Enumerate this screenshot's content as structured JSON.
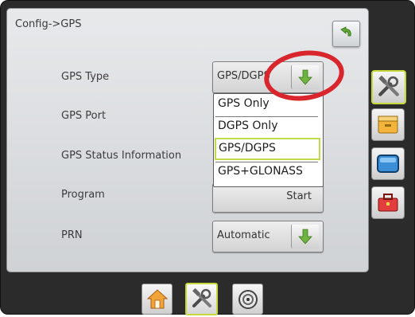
{
  "breadcrumb": "Config->GPS",
  "rows": [
    {
      "label": "GPS Type"
    },
    {
      "label": "GPS Port"
    },
    {
      "label": "GPS Status Information"
    },
    {
      "label": "Program",
      "button": "Start"
    },
    {
      "label": "PRN",
      "value": "Automatic"
    }
  ],
  "gps_type": {
    "value": "GPS/DGPS",
    "options": [
      "GPS Only",
      "DGPS Only",
      "GPS/DGPS",
      "GPS+GLONASS"
    ],
    "selected": "GPS/DGPS"
  },
  "icons": {
    "back": "back-arrow-icon",
    "dropdown": "green-down-arrow-icon",
    "home": "home-icon",
    "config": "tools-icon",
    "gauge": "gauge-icon",
    "side_tools": "tools-icon",
    "side_folder": "folder-icon",
    "side_screen": "screen-icon",
    "side_toolbox": "toolbox-icon"
  },
  "colors": {
    "accent": "#c1dc4a",
    "green_arrow": "#6cb33f",
    "annotation": "#d8262c"
  }
}
